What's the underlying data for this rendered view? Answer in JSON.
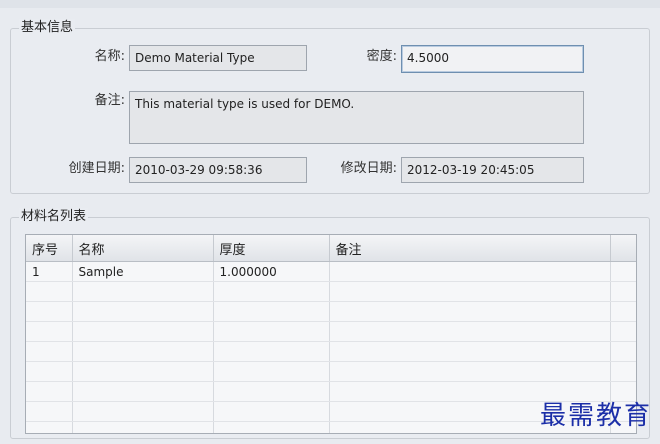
{
  "basic_info": {
    "title": "基本信息",
    "name_label": "名称:",
    "name_value": "Demo Material Type",
    "density_label": "密度:",
    "density_value": "4.5000",
    "remark_label": "备注:",
    "remark_value": "This material type is used for DEMO.",
    "created_label": "创建日期:",
    "created_value": "2010-03-29 09:58:36",
    "modified_label": "修改日期:",
    "modified_value": "2012-03-19 20:45:05"
  },
  "material_list": {
    "title": "材料名列表",
    "columns": [
      "序号",
      "名称",
      "厚度",
      "备注"
    ],
    "rows": [
      [
        "1",
        "Sample",
        "1.000000",
        ""
      ]
    ]
  },
  "watermark": "最需教育"
}
